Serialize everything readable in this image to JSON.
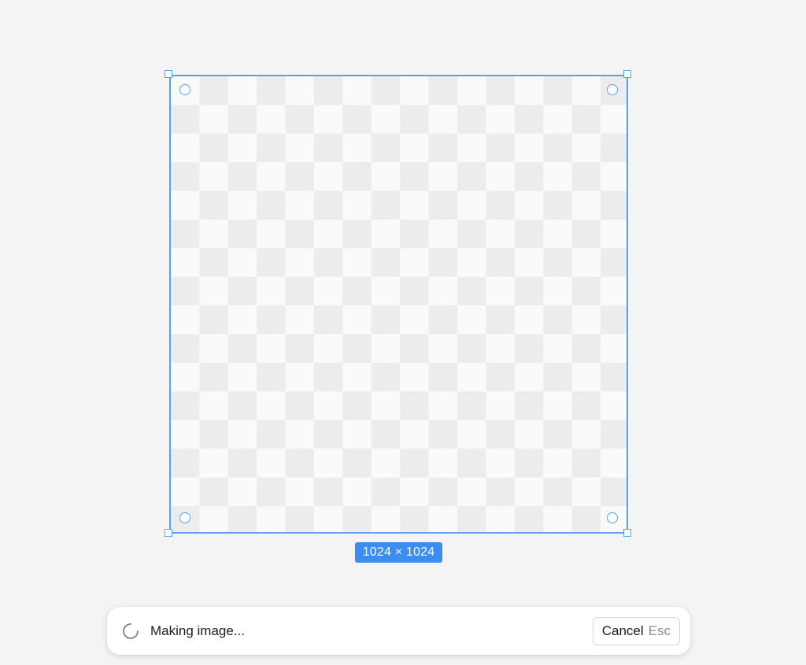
{
  "canvas": {
    "size_label": "1024 × 1024"
  },
  "toast": {
    "status": "Making image...",
    "spinner_icon": "loading-spinner-icon",
    "cancel_label": "Cancel",
    "cancel_shortcut": "Esc"
  },
  "colors": {
    "selection": "#5aa0ee",
    "badge": "#3d8cf0",
    "background": "#f4f4f4"
  }
}
